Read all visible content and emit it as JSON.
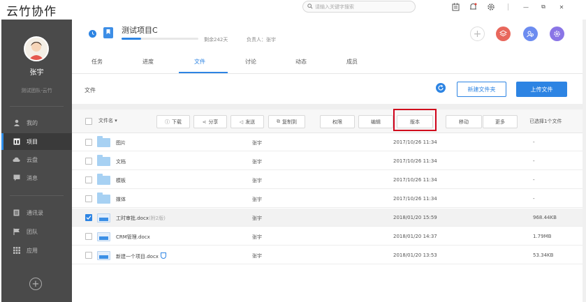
{
  "app": {
    "title": "云竹协作"
  },
  "search": {
    "placeholder": "请输入关键字搜索"
  },
  "window_controls": {
    "minimize": "—",
    "restore": "⧉",
    "close": "✕"
  },
  "sidebar": {
    "user_name": "张宇",
    "team_name": "测试团队-云竹",
    "items": [
      {
        "label": "我的",
        "icon": "person-icon"
      },
      {
        "label": "项目",
        "icon": "project-icon",
        "active": true
      },
      {
        "label": "云盘",
        "icon": "cloud-icon"
      },
      {
        "label": "消息",
        "icon": "message-icon"
      },
      {
        "label": "通讯录",
        "icon": "contacts-icon"
      },
      {
        "label": "团队",
        "icon": "flag-icon"
      },
      {
        "label": "应用",
        "icon": "apps-icon"
      }
    ],
    "add_symbol": "+"
  },
  "project": {
    "title": "测试项目C",
    "remaining": "剩余242天",
    "owner": "负责人：张宇",
    "progress_percent": 25
  },
  "tabs": [
    "任务",
    "进度",
    "文件",
    "讨论",
    "动态",
    "成员"
  ],
  "active_tab": "文件",
  "folder": {
    "label": "文件",
    "new_folder_label": "新建文件夹",
    "upload_label": "上传文件"
  },
  "toolbar": {
    "filename_header": "文件名 ▾",
    "download": "下载",
    "share": "分享",
    "send": "发送",
    "copy_to": "复制到",
    "permissions": "权限",
    "edit": "编辑",
    "version": "版本",
    "move": "移动",
    "more": "更多",
    "selected_count": "已选择1个文件"
  },
  "files": [
    {
      "name": "图片",
      "note": "",
      "type": "folder",
      "owner": "张宇",
      "time": "2017/10/26 11:34",
      "size": "-",
      "selected": false,
      "shield": false
    },
    {
      "name": "文档",
      "note": "",
      "type": "folder",
      "owner": "张宇",
      "time": "2017/10/26 11:34",
      "size": "-",
      "selected": false,
      "shield": false
    },
    {
      "name": "模板",
      "note": "",
      "type": "folder",
      "owner": "张宇",
      "time": "2017/10/26 11:34",
      "size": "-",
      "selected": false,
      "shield": false
    },
    {
      "name": "媒体",
      "note": "",
      "type": "folder",
      "owner": "张宇",
      "time": "2017/10/26 11:34",
      "size": "-",
      "selected": false,
      "shield": false
    },
    {
      "name": "工时审批.docx",
      "note": "(附2版)",
      "type": "doc",
      "owner": "张宇",
      "time": "2018/01/20 15:59",
      "size": "968.44KB",
      "selected": true,
      "shield": false
    },
    {
      "name": "CRM管理.docx",
      "note": "",
      "type": "doc",
      "owner": "张宇",
      "time": "2018/01/20 14:37",
      "size": "1.79MB",
      "selected": false,
      "shield": false
    },
    {
      "name": "新建一个项目.docx",
      "note": "",
      "type": "doc",
      "owner": "张宇",
      "time": "2018/01/20 13:53",
      "size": "53.34KB",
      "selected": false,
      "shield": true
    }
  ],
  "colors": {
    "accent": "#2d84e3",
    "sidebar_bg": "#4a4a4a",
    "highlight_border": "#d0021b"
  }
}
